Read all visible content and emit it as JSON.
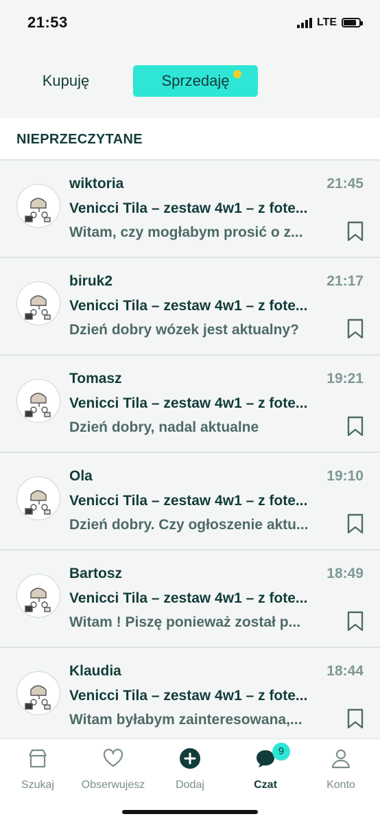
{
  "status_bar": {
    "time": "21:53",
    "network": "LTE",
    "battery_level": 0.8
  },
  "tabs": {
    "buy": "Kupuję",
    "sell": "Sprzedaję",
    "active": "sell"
  },
  "section": {
    "title": "NIEPRZECZYTANE"
  },
  "chats": [
    {
      "name": "wiktoria",
      "time": "21:45",
      "title": "Venicci Tila – zestaw 4w1 – z fote...",
      "preview": "Witam, czy mogłabym prosić o z..."
    },
    {
      "name": "biruk2",
      "time": "21:17",
      "title": "Venicci Tila – zestaw 4w1 – z fote...",
      "preview": "Dzień dobry wózek jest aktualny?"
    },
    {
      "name": "Tomasz",
      "time": "19:21",
      "title": "Venicci Tila – zestaw 4w1 – z fote...",
      "preview": "Dzień dobry, nadal aktualne"
    },
    {
      "name": "Ola",
      "time": "19:10",
      "title": "Venicci Tila – zestaw 4w1 – z fote...",
      "preview": "Dzień dobry. Czy ogłoszenie aktu..."
    },
    {
      "name": "Bartosz",
      "time": "18:49",
      "title": "Venicci Tila – zestaw 4w1 – z fote...",
      "preview": "Witam ! Piszę ponieważ został p..."
    },
    {
      "name": "Klaudia",
      "time": "18:44",
      "title": "Venicci Tila – zestaw 4w1 – z fote...",
      "preview": "Witam byłabym zainteresowana,..."
    }
  ],
  "nav": {
    "search": "Szukaj",
    "watch": "Obserwujesz",
    "add": "Dodaj",
    "chat": "Czat",
    "account": "Konto",
    "chat_badge": "9"
  },
  "colors": {
    "accent": "#2ee6d6",
    "dark": "#123c3a",
    "dot": "#f2cf2e",
    "muted": "#7f9896"
  }
}
